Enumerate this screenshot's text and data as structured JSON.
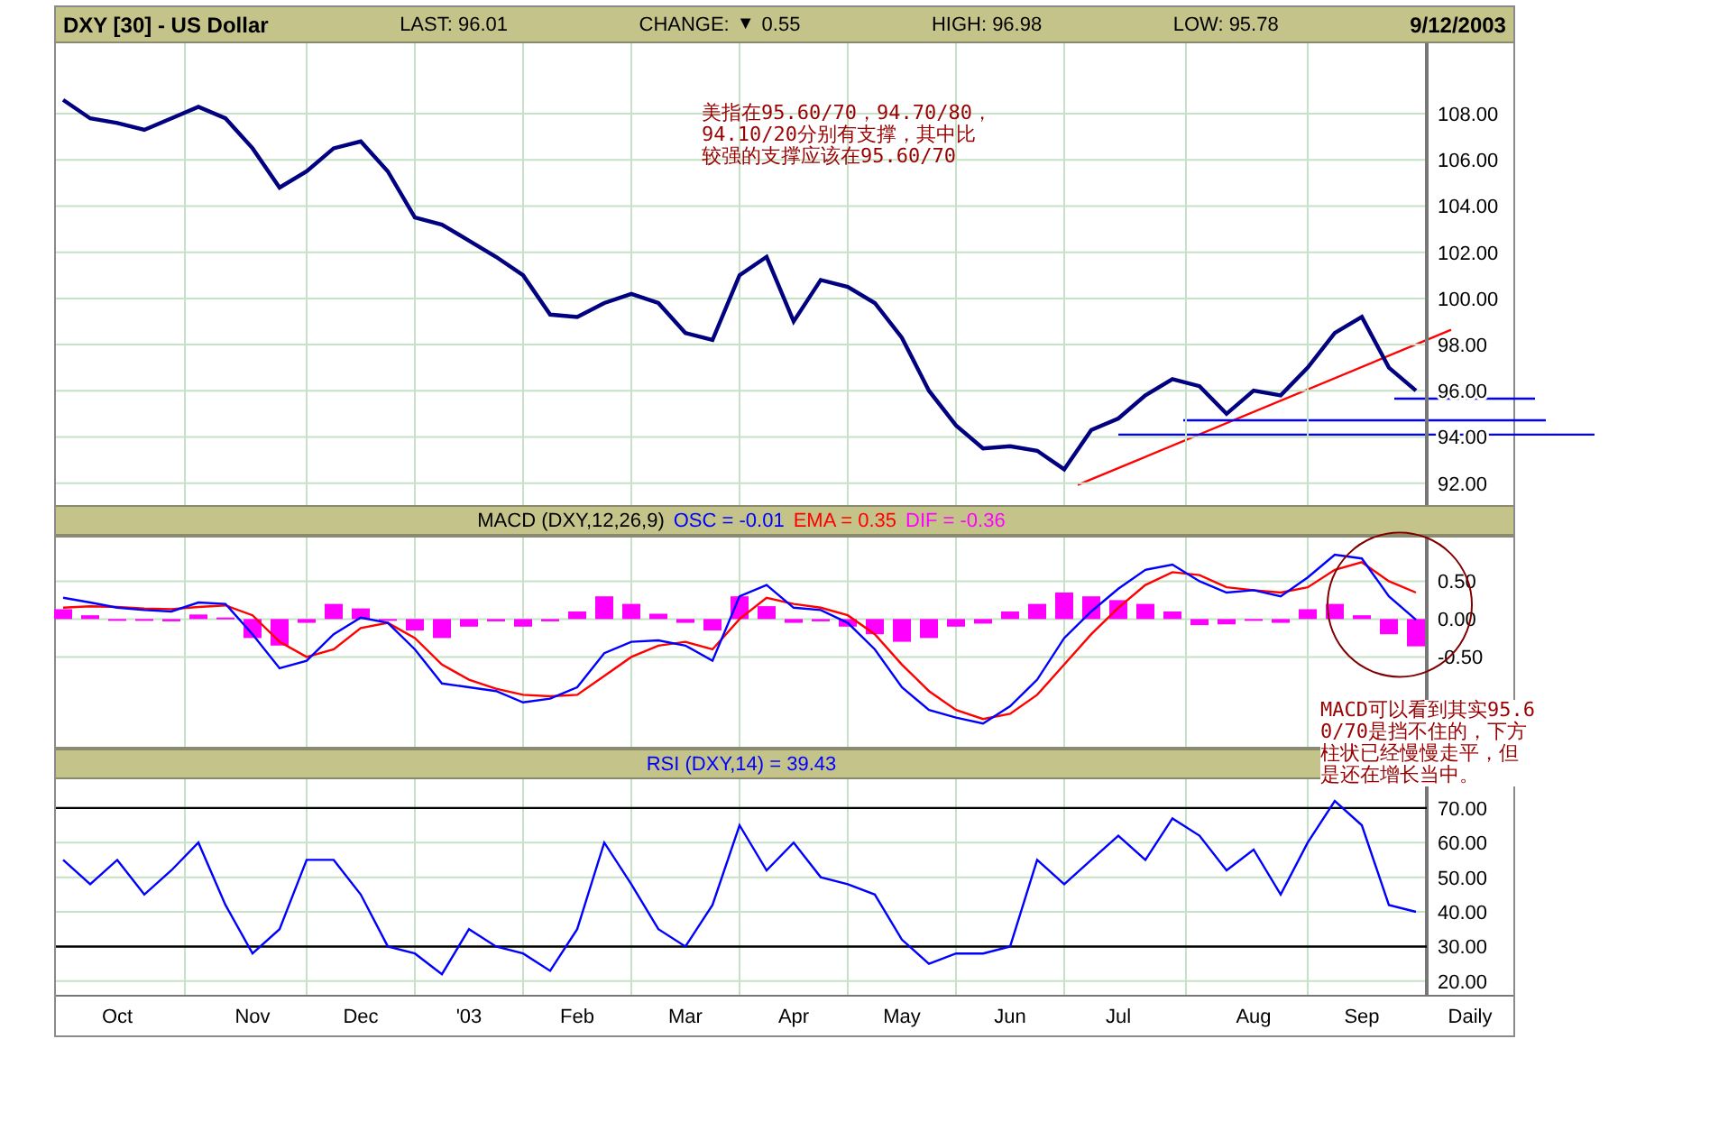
{
  "header": {
    "symbol": "DXY [30] - US Dollar",
    "last": "LAST: 96.01",
    "change_label": "CHANGE:",
    "change_marker": "▼",
    "change": "0.55",
    "high": "HIGH: 96.98",
    "low": "LOW: 95.78",
    "date": "9/12/2003"
  },
  "price_panel": {
    "chart_data": {
      "type": "line",
      "grid": true,
      "series": [
        {
          "color": "#000080",
          "values": [
            108.6,
            107.8,
            107.6,
            107.3,
            107.8,
            108.3,
            107.8,
            106.5,
            104.8,
            105.5,
            106.5,
            106.8,
            105.5,
            103.5,
            103.2,
            102.5,
            101.8,
            101,
            99.3,
            99.2,
            99.8,
            100.2,
            99.8,
            98.5,
            98.2,
            101,
            101.8,
            99,
            100.8,
            100.5,
            99.8,
            98.3,
            96,
            94.5,
            93.5,
            93.6,
            93.4,
            92.6,
            94.3,
            94.8,
            95.8,
            96.5,
            96.2,
            95,
            96,
            95.8,
            97,
            98.5,
            99.2,
            97,
            96
          ]
        }
      ],
      "ylim": [
        91.05,
        111.05
      ],
      "yticks": [
        {
          "value": 92,
          "label": "92.00"
        },
        {
          "value": 94,
          "label": "94.00"
        },
        {
          "value": 96,
          "label": "96.00"
        },
        {
          "value": 98,
          "label": "98.00"
        },
        {
          "value": 100,
          "label": "100.00"
        },
        {
          "value": 102,
          "label": "102.00"
        },
        {
          "value": 104,
          "label": "104.00"
        },
        {
          "value": 106,
          "label": "106.00"
        },
        {
          "value": 108,
          "label": "108.00"
        }
      ]
    },
    "note": "美指在95.60/70，94.70/80，94.10/20分别有支撑，其中比较强的支撑应该在95.60/70"
  },
  "macd_panel": {
    "title": "MACD (DXY,12,26,9)",
    "legend": [
      {
        "text": "OSC = -0.01",
        "color": "#0000ff"
      },
      {
        "text": "EMA = 0.35",
        "color": "#ff0000"
      },
      {
        "text": "DIF = -0.36",
        "color": "#ff00ff"
      }
    ],
    "histogram": {
      "chart_data": {
        "type": "bar",
        "grid": true,
        "series": [
          {
            "color": "#ff00ff",
            "values": [
              0.13,
              0.05,
              -0.01,
              -0.02,
              -0.03,
              0.06,
              0.02,
              -0.25,
              -0.35,
              -0.05,
              0.2,
              0.14,
              0,
              -0.15,
              -0.25,
              -0.1,
              -0.03,
              -0.1,
              -0.03,
              0.1,
              0.3,
              0.2,
              0.07,
              -0.05,
              -0.15,
              0.3,
              0.17,
              -0.05,
              -0.03,
              -0.1,
              -0.2,
              -0.3,
              -0.25,
              -0.1,
              -0.06,
              0.1,
              0.2,
              0.35,
              0.3,
              0.25,
              0.2,
              0.1,
              -0.08,
              -0.07,
              0,
              -0.05,
              0.13,
              0.2,
              0.05,
              -0.2,
              -0.36
            ]
          }
        ],
        "ylim": [
          -1.71,
          1.1
        ],
        "yticks": [
          {
            "value": -0.5,
            "label": "-0.50"
          },
          {
            "value": 0,
            "label": "0.00"
          },
          {
            "value": 0.5,
            "label": "0.50"
          }
        ]
      }
    },
    "lines": {
      "chart_data": {
        "type": "line",
        "series": [
          {
            "color": "#ff0000",
            "values": [
              0.15,
              0.17,
              0.16,
              0.14,
              0.13,
              0.16,
              0.18,
              0.05,
              -0.3,
              -0.5,
              -0.4,
              -0.12,
              -0.05,
              -0.25,
              -0.6,
              -0.8,
              -0.92,
              -1,
              -1.02,
              -1,
              -0.75,
              -0.5,
              -0.35,
              -0.3,
              -0.4,
              0,
              0.28,
              0.2,
              0.15,
              0.05,
              -0.2,
              -0.6,
              -0.95,
              -1.2,
              -1.32,
              -1.25,
              -1,
              -0.6,
              -0.2,
              0.15,
              0.45,
              0.62,
              0.58,
              0.42,
              0.38,
              0.35,
              0.42,
              0.65,
              0.75,
              0.5,
              0.35
            ]
          },
          {
            "color": "#0000ff",
            "values": [
              0.28,
              0.22,
              0.15,
              0.12,
              0.1,
              0.22,
              0.2,
              -0.2,
              -0.65,
              -0.55,
              -0.2,
              0.02,
              -0.05,
              -0.4,
              -0.85,
              -0.9,
              -0.95,
              -1.1,
              -1.05,
              -0.9,
              -0.45,
              -0.3,
              -0.28,
              -0.35,
              -0.55,
              0.3,
              0.45,
              0.15,
              0.12,
              -0.05,
              -0.4,
              -0.9,
              -1.2,
              -1.3,
              -1.38,
              -1.15,
              -0.8,
              -0.25,
              0.1,
              0.4,
              0.65,
              0.72,
              0.5,
              0.35,
              0.38,
              0.3,
              0.55,
              0.85,
              0.8,
              0.3,
              -0.01
            ]
          }
        ],
        "ylim": [
          -1.71,
          1.1
        ]
      }
    },
    "note": "MACD可以看到其实95.60/70是挡不住的，下方柱状已经慢慢走平，但是还在增长当中。"
  },
  "rsi_panel": {
    "title": "RSI (DXY,14) = 39.43",
    "chart_data": {
      "type": "line",
      "grid": true,
      "categories": [
        null,
        null,
        "Oct",
        null,
        null,
        null,
        null,
        "Nov",
        null,
        null,
        null,
        "Dec",
        null,
        null,
        null,
        "'03",
        null,
        null,
        null,
        "Feb",
        null,
        null,
        null,
        "Mar",
        null,
        null,
        null,
        "Apr",
        null,
        null,
        null,
        "May",
        null,
        null,
        null,
        "Jun",
        null,
        null,
        null,
        "Jul",
        null,
        null,
        null,
        null,
        "Aug",
        null,
        null,
        null,
        "Sep",
        null,
        null
      ],
      "series": [
        {
          "color": "#0000ff",
          "values": [
            55,
            48,
            55,
            45,
            52,
            60,
            42,
            28,
            35,
            55,
            55,
            45,
            30,
            28,
            22,
            35,
            30,
            28,
            23,
            35,
            60,
            48,
            35,
            30,
            42,
            65,
            52,
            60,
            50,
            48,
            45,
            32,
            25,
            28,
            28,
            30,
            55,
            48,
            55,
            62,
            55,
            67,
            62,
            52,
            58,
            45,
            60,
            72,
            65,
            42,
            40
          ]
        }
      ],
      "ylim": [
        15.8,
        78.3
      ],
      "yticks": [
        {
          "value": 20,
          "label": "20.00"
        },
        {
          "value": 30,
          "label": "30.00"
        },
        {
          "value": 40,
          "label": "40.00"
        },
        {
          "value": 50,
          "label": "50.00"
        },
        {
          "value": 60,
          "label": "60.00"
        },
        {
          "value": 70,
          "label": "70.00"
        }
      ]
    },
    "period_label": "Daily"
  }
}
